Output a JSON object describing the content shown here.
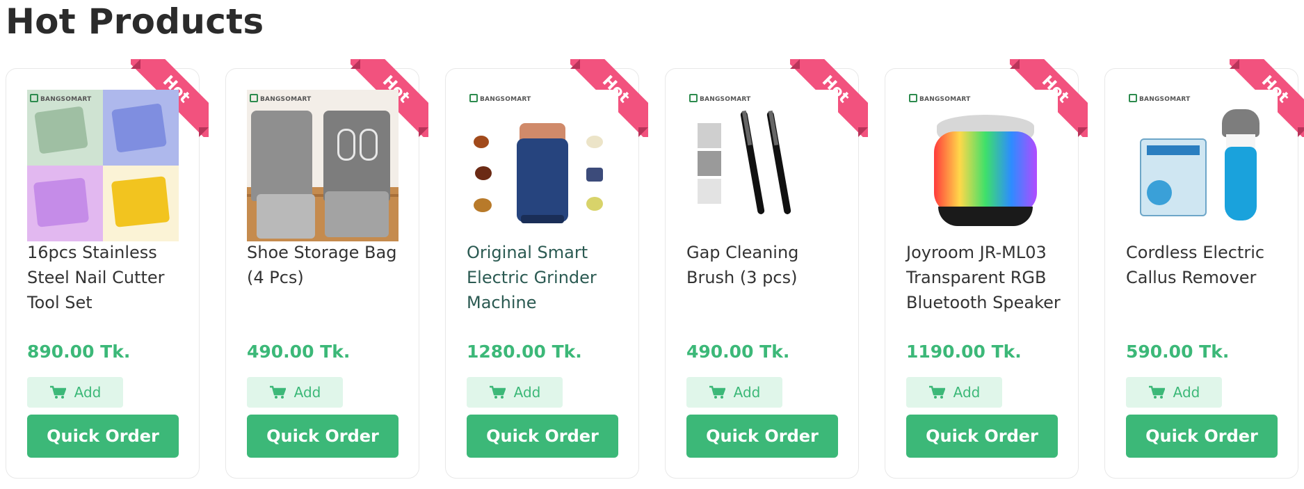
{
  "section": {
    "title": "Hot Products"
  },
  "ribbon_label": "Hot",
  "brand_label": "BANGSOMART",
  "products": [
    {
      "title": "16pcs Stainless Steel Nail Cutter Tool Set",
      "price": "890.00 Tk.",
      "add_label": "Add",
      "quick_label": "Quick Order",
      "title_style": "normal"
    },
    {
      "title": "Shoe Storage Bag (4 Pcs)",
      "price": "490.00 Tk.",
      "add_label": "Add",
      "quick_label": "Quick Order",
      "title_style": "normal"
    },
    {
      "title": "Original Smart Electric Grinder Machine",
      "price": "1280.00 Tk.",
      "add_label": "Add",
      "quick_label": "Quick Order",
      "title_style": "link"
    },
    {
      "title": "Gap Cleaning Brush (3 pcs)",
      "price": "490.00 Tk.",
      "add_label": "Add",
      "quick_label": "Quick Order",
      "title_style": "normal"
    },
    {
      "title": "Joyroom JR-ML03 Transparent RGB Bluetooth Speaker",
      "price": "1190.00 Tk.",
      "add_label": "Add",
      "quick_label": "Quick Order",
      "title_style": "normal"
    },
    {
      "title": "Cordless Electric Callus Remover",
      "price": "590.00 Tk.",
      "add_label": "Add",
      "quick_label": "Quick Order",
      "title_style": "normal"
    }
  ],
  "colors": {
    "accent": "#3cb878",
    "accent_light": "#e0f6ea",
    "ribbon": "#f2527e",
    "title_link": "#2b5a52"
  },
  "icons": {
    "add": "shopping-cart-icon"
  }
}
